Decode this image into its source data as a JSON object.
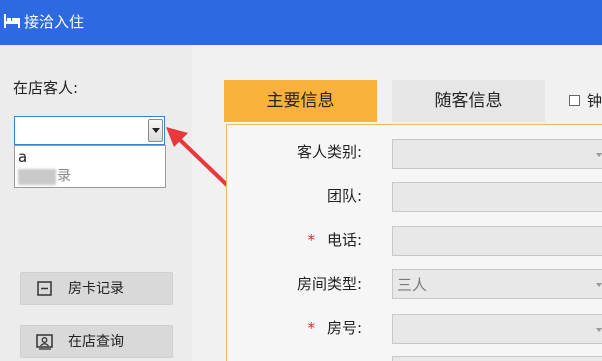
{
  "window": {
    "title": "接洽入住",
    "icon": "bed-icon"
  },
  "left": {
    "guests_label": "在店客人:",
    "combo": {
      "value": "",
      "icon": "chevron-down-icon"
    },
    "dropdown_options": [
      "a",
      "录"
    ],
    "buttons": [
      {
        "label": "房卡记录",
        "icon": "minus-box-icon"
      },
      {
        "label": "在店查询",
        "icon": "guest-card-icon"
      }
    ]
  },
  "tabs": [
    {
      "label": "主要信息",
      "active": true
    },
    {
      "label": "随客信息",
      "active": false
    }
  ],
  "checkbox": {
    "label": "钟",
    "checked": false
  },
  "form": {
    "fields": [
      {
        "label": "客人类别:",
        "required": false,
        "value": "",
        "type": "select"
      },
      {
        "label": "团队:",
        "required": false,
        "value": "",
        "type": "text"
      },
      {
        "label": "电话:",
        "required": true,
        "value": "",
        "type": "text"
      },
      {
        "label": "房间类型:",
        "required": false,
        "value": "三人",
        "type": "select"
      },
      {
        "label": "房号:",
        "required": true,
        "value": "",
        "type": "select"
      }
    ],
    "required_mark": "*"
  },
  "colors": {
    "titlebar": "#2d69e0",
    "active_tab": "#f8b23c",
    "annotation_arrow": "#e8383d",
    "required": "#e0262a"
  }
}
